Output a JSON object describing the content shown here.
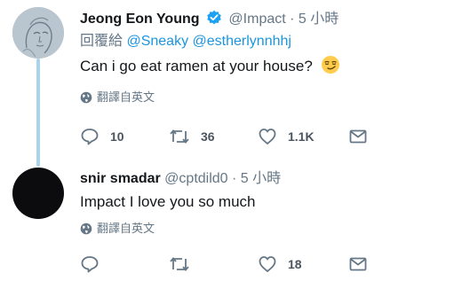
{
  "tweets": [
    {
      "name": "Jeong Eon Young",
      "handle": "@Impact",
      "separator": "·",
      "time": "5 小時",
      "replying_label": "回覆給",
      "mentions": [
        "@Sneaky",
        "@estherlynnhhj"
      ],
      "text": "Can i go eat ramen at your house?",
      "translate": "翻譯自英文",
      "actions": {
        "reply": "10",
        "retweet": "36",
        "like": "1.1K",
        "dm": ""
      }
    },
    {
      "name": "snir smadar",
      "handle": "@cptdild0",
      "separator": "·",
      "time": "5 小時",
      "text": "Impact I love you so much",
      "translate": "翻譯自英文",
      "actions": {
        "reply": "",
        "retweet": "",
        "like": "18",
        "dm": ""
      }
    }
  ],
  "colors": {
    "accent": "#1b95e0",
    "muted": "#657786",
    "verified": "#1da1f2",
    "thread_line": "#a9d4ec"
  },
  "icons": [
    "verified-badge-icon",
    "globe-icon",
    "reply-icon",
    "retweet-icon",
    "like-icon",
    "direct-message-icon",
    "smirk-emoji-icon"
  ]
}
